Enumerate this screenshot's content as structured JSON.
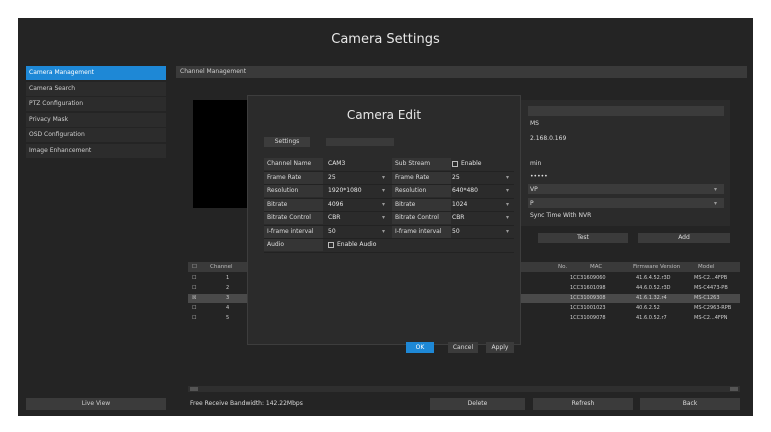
{
  "app": {
    "title": "Camera Settings"
  },
  "sidebar": {
    "items": [
      {
        "label": "Camera Management",
        "active": true
      },
      {
        "label": "Camera Search",
        "active": false
      },
      {
        "label": "PTZ Configuration",
        "active": false
      },
      {
        "label": "Privacy Mask",
        "active": false
      },
      {
        "label": "OSD Configuration",
        "active": false
      },
      {
        "label": "Image Enhancement",
        "active": false
      }
    ],
    "live_view": "Live View"
  },
  "tab": {
    "label": "Channel Management"
  },
  "right_panel": {
    "name_value": "MS",
    "ip_value": "2.168.0.169",
    "port_label": "min",
    "password_mask": "•••••",
    "protocol_value": "VP",
    "http_value": "P",
    "sync_label": "Sync Time With NVR",
    "test_button": "Test",
    "add_button": "Add"
  },
  "table": {
    "headers": [
      "Channel",
      "No.",
      "MAC",
      "Firmware Version",
      "Model"
    ],
    "rows": [
      {
        "idx": "1",
        "mac": "1CC31609060",
        "fw": "41.6.4.52.r3D",
        "model": "MS-C2...4FPB"
      },
      {
        "idx": "2",
        "mac": "1CC31601098",
        "fw": "44.6.0.52.r3D",
        "model": "MS-C4473-PB"
      },
      {
        "idx": "3",
        "mac": "1CC31009308",
        "fw": "41.6.1.32.r4",
        "model": "MS-C1263",
        "selected": true
      },
      {
        "idx": "4",
        "mac": "1CC31001023",
        "fw": "40.6.2.52",
        "model": "MS-C2963-RPB"
      },
      {
        "idx": "5",
        "mac": "1CC31009078",
        "fw": "41.6.0.52.r7",
        "model": "MS-C2...4FPN"
      }
    ]
  },
  "footer": {
    "bandwidth": "Free Receive Bandwidth: 142.22Mbps",
    "delete": "Delete",
    "refresh": "Refresh",
    "back": "Back"
  },
  "modal": {
    "title": "Camera Edit",
    "settings_tab": "Settings",
    "fields": {
      "channel_name_label": "Channel Name",
      "channel_name_value": "CAM3",
      "sub_stream_label": "Sub Stream",
      "sub_stream_enable": "Enable",
      "frame_rate_label": "Frame Rate",
      "frame_rate_main": "25",
      "frame_rate_sub": "25",
      "resolution_label": "Resolution",
      "resolution_main": "1920*1080",
      "resolution_sub": "640*480",
      "bitrate_label": "Bitrate",
      "bitrate_main": "4096",
      "bitrate_sub": "1024",
      "bitrate_control_label": "Bitrate Control",
      "bitrate_control_main": "CBR",
      "bitrate_control_sub": "CBR",
      "iframe_label": "I-frame interval",
      "iframe_main": "50",
      "iframe_sub": "50",
      "audio_label": "Audio",
      "audio_enable": "Enable Audio"
    },
    "ok": "OK",
    "cancel": "Cancel",
    "apply": "Apply"
  },
  "colors": {
    "accent": "#1e88d6",
    "background": "#242424"
  }
}
